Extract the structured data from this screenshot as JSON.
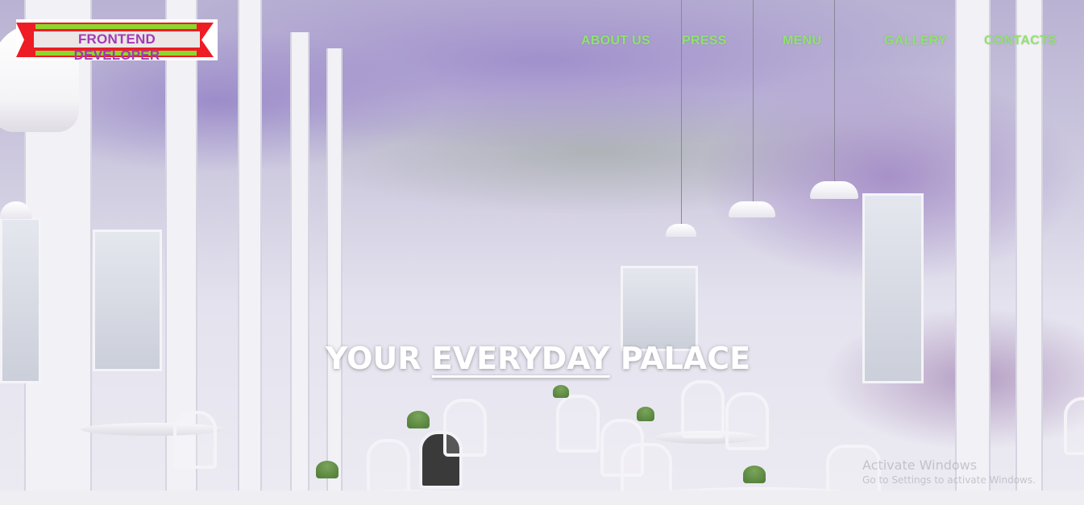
{
  "brand": {
    "logo_text": "FRONTEND DEVELOPER",
    "colors": {
      "band": "#ee1c24",
      "stripe": "#8bd82d",
      "text": "#a23bb3"
    }
  },
  "nav": {
    "items": [
      {
        "label": "ABOUT US"
      },
      {
        "label": "PRESS"
      },
      {
        "label": "MENU"
      },
      {
        "label": "GALLERY"
      },
      {
        "label": "CONTACTS"
      }
    ],
    "color": "#8fe36e"
  },
  "hero": {
    "headline_before": "YOUR ",
    "headline_underlined": "EVERYDAY",
    "headline_after": " PALACE",
    "image": "restaurant-interior-with-hanging-wisteria"
  },
  "watermark": {
    "line1": "Activate Windows",
    "line2": "Go to Settings to activate Windows."
  }
}
